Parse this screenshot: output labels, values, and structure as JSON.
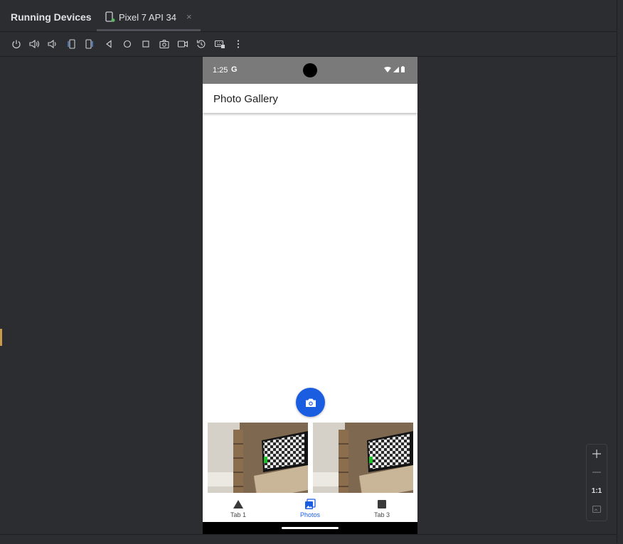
{
  "panel": {
    "title": "Running Devices"
  },
  "device_tab": {
    "label": "Pixel 7 API 34",
    "close": "×"
  },
  "toolbar": {
    "icons": [
      "power-icon",
      "volume-up-icon",
      "volume-down-icon",
      "rotate-left-icon",
      "rotate-right-icon",
      "back-icon",
      "home-icon",
      "overview-icon",
      "screenshot-icon",
      "screen-record-icon",
      "reset-icon",
      "keyboard-icon",
      "more-icon"
    ]
  },
  "device": {
    "status_bar": {
      "time": "1:25",
      "g": "G"
    },
    "app_bar": {
      "title": "Photo Gallery"
    },
    "bottom_nav": [
      {
        "label": "Tab 1",
        "icon": "triangle-icon"
      },
      {
        "label": "Photos",
        "icon": "photos-icon",
        "active": true
      },
      {
        "label": "Tab 3",
        "icon": "square-icon"
      }
    ],
    "accent": "#1b5de0"
  },
  "zoom": {
    "one_to_one": "1:1"
  }
}
